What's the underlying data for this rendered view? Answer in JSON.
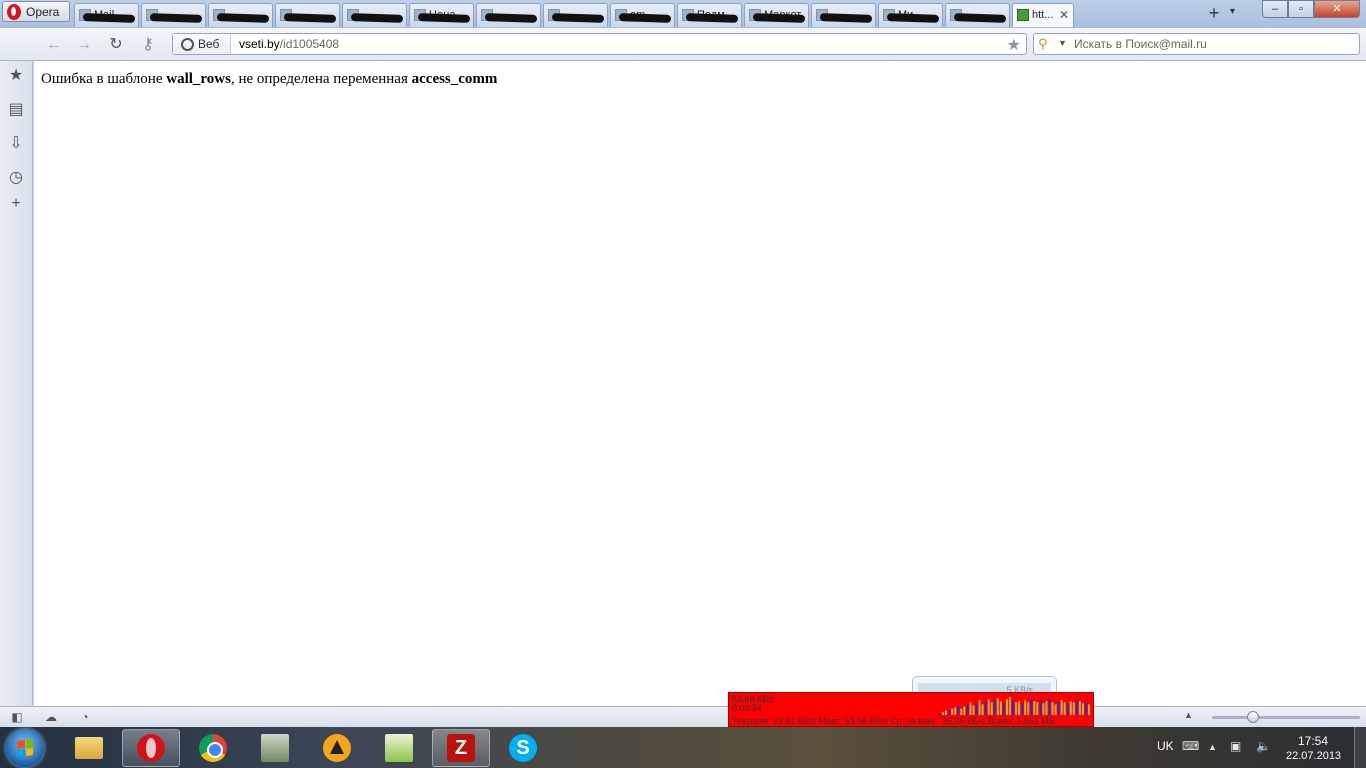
{
  "browser": {
    "menu_label": "Opera",
    "tabs": [
      {
        "title": "Mail"
      },
      {
        "title": ""
      },
      {
        "title": ""
      },
      {
        "title": ""
      },
      {
        "title": ""
      },
      {
        "title": "Цена"
      },
      {
        "title": ""
      },
      {
        "title": ""
      },
      {
        "title": "em"
      },
      {
        "title": "Подм"
      },
      {
        "title": "Маркет"
      },
      {
        "title": ""
      },
      {
        "title": "Ми"
      },
      {
        "title": ""
      },
      {
        "title": "htt...",
        "active": true
      }
    ],
    "new_tab_label": "+",
    "window_controls": {
      "minimize": "–",
      "maximize": "▫",
      "close": "✕"
    }
  },
  "address_bar": {
    "badge": "Веб",
    "host": "vseti.by",
    "path": "/id1005408"
  },
  "search_bar": {
    "placeholder": "Искать в Поиск@mail.ru"
  },
  "page": {
    "error_prefix": "Ошибка в шаблоне ",
    "template_name": "wall_rows",
    "error_middle": ", не определена переменная ",
    "variable_name": "access_comm"
  },
  "net_monitor": {
    "current_speed": "53,66 КБ/с",
    "elapsed": "0:00:54",
    "stats": "Текущая: 23,41 КБ/с   Макс: 53,66 КБ/с   Ср. за мин.: 26,26 КБ/с   Всего: 1,661 МБ",
    "tooltip": "5 KB/s",
    "color": "#ff0000",
    "bars": [
      2,
      3,
      4,
      5,
      6,
      7,
      9,
      6,
      8,
      10,
      12,
      9,
      11,
      14,
      10,
      13,
      15,
      12,
      14,
      16,
      13,
      11,
      15,
      17,
      14,
      12,
      13,
      11,
      14,
      12,
      15,
      13,
      12,
      14,
      11,
      13,
      15,
      12,
      10,
      13,
      14,
      12,
      11,
      13,
      12,
      14,
      13,
      11,
      12,
      10
    ]
  },
  "zoom_level_fraction": 0.28,
  "taskbar": {
    "language": "UK",
    "time": "17:54",
    "date": "22.07.2013"
  }
}
